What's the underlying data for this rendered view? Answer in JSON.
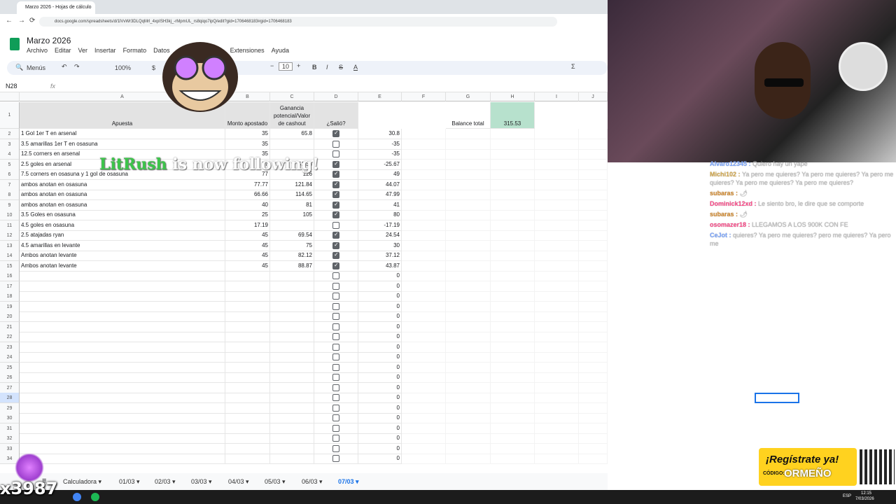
{
  "browser": {
    "tab_title": "Marzo 2026 - Hojas de cálculo",
    "url": "docs.google.com/spreadsheets/d/1lVvWr3DLQqMrl_4xpISH3kj_-rMpmUL_rs8qiqo7ipQ/edit?gid=1706468183#gid=1706468183"
  },
  "sheet": {
    "title": "Marzo 2026",
    "menu": [
      "Archivo",
      "Editar",
      "Ver",
      "Insertar",
      "Formato",
      "Datos",
      "Extensiones",
      "Ayuda"
    ],
    "toolbar": {
      "menus": "Menús",
      "zoom": "100%",
      "currency": "$",
      "font_size": "10"
    },
    "cell_ref": "N28",
    "fx": "fx",
    "columns": [
      "A",
      "B",
      "C",
      "D",
      "E",
      "F",
      "G",
      "H",
      "I",
      "J"
    ],
    "headers": {
      "a": "Apuesta",
      "b": "Monto apostado",
      "c": "Ganancia potencial/Valor de cashout",
      "d": "¿Salió?",
      "g": "Balance total",
      "h": "315.53"
    },
    "rows": [
      {
        "n": "2",
        "a": "1 Gol 1er T en arsenal",
        "b": "35",
        "c": "65.8",
        "checked": true,
        "e": "30.8"
      },
      {
        "n": "3",
        "a": "3.5 amarillas 1er T en osasuna",
        "b": "35",
        "c": "",
        "checked": false,
        "e": "-35"
      },
      {
        "n": "4",
        "a": "12.5 corners en arsenal",
        "b": "35",
        "c": "",
        "checked": false,
        "e": "-35"
      },
      {
        "n": "5",
        "a": "2.5 goles en arsenal",
        "b": "77",
        "c": "51.33",
        "checked": true,
        "e": "-25.67"
      },
      {
        "n": "6",
        "a": "7.5 corners en osasuna y 1 gol de osasuna",
        "b": "77",
        "c": "126",
        "checked": true,
        "e": "49"
      },
      {
        "n": "7",
        "a": "ambos anotan en osasuna",
        "b": "77.77",
        "c": "121.84",
        "checked": true,
        "e": "44.07"
      },
      {
        "n": "8",
        "a": "ambos anotan en osasuna",
        "b": "66.66",
        "c": "114.65",
        "checked": true,
        "e": "47.99"
      },
      {
        "n": "9",
        "a": "ambos anotan en osasuna",
        "b": "40",
        "c": "81",
        "checked": true,
        "e": "41"
      },
      {
        "n": "10",
        "a": "3.5 Goles en osasuna",
        "b": "25",
        "c": "105",
        "checked": true,
        "e": "80"
      },
      {
        "n": "11",
        "a": "4.5 goles en osasuna",
        "b": "17.19",
        "c": "",
        "checked": false,
        "e": "-17.19"
      },
      {
        "n": "12",
        "a": "2.5 atajadas ryan",
        "b": "45",
        "c": "69.54",
        "checked": true,
        "e": "24.54"
      },
      {
        "n": "13",
        "a": "4.5 amarillas en levante",
        "b": "45",
        "c": "75",
        "checked": true,
        "e": "30"
      },
      {
        "n": "14",
        "a": "Ambos anotan levante",
        "b": "45",
        "c": "82.12",
        "checked": true,
        "e": "37.12"
      },
      {
        "n": "15",
        "a": "Ambos anotan levante",
        "b": "45",
        "c": "88.87",
        "checked": true,
        "e": "43.87"
      }
    ],
    "empty_rows": [
      "16",
      "17",
      "18",
      "19",
      "20",
      "21",
      "22",
      "23",
      "24",
      "25",
      "26",
      "27",
      "28",
      "29",
      "30",
      "31",
      "32",
      "33",
      "34"
    ],
    "empty_e": "0",
    "sheet_tabs": [
      "Calculadora",
      "01/03",
      "02/03",
      "03/03",
      "04/03",
      "05/03",
      "06/03",
      "07/03"
    ],
    "active_tab": "07/03"
  },
  "overlay": {
    "follow_user": "LitRush",
    "follow_text": " is now following!",
    "counter": "x3987",
    "promo_line1": "¡Regístrate ya!",
    "promo_code_label": "CÓDIGO:",
    "promo_code": "ORMEÑO"
  },
  "chat": [
    {
      "user": "Alvaro12345",
      "text": "Quiero hay un yape"
    },
    {
      "user": "Michi102",
      "text": "Ya pero me quieres? Ya pero me quieres? Ya pero me quieres? Ya pero me quieres? Ya pero me quieres?"
    },
    {
      "user": "subaras",
      "text": "🌶"
    },
    {
      "user": "Dominick12xd",
      "text": "Le siento bro, le dire que se comporte"
    },
    {
      "user": "subaras",
      "text": "🌶"
    },
    {
      "user": "osomazer18",
      "text": "LLEGAMOS A LOS 900K CON FE"
    },
    {
      "user": "CeJot",
      "text": "quieres? Ya pero me quieres? pero me quieres? Ya pero me"
    }
  ],
  "taskbar": {
    "time": "12:15",
    "date": "7/03/2026",
    "lang": "ESP"
  }
}
